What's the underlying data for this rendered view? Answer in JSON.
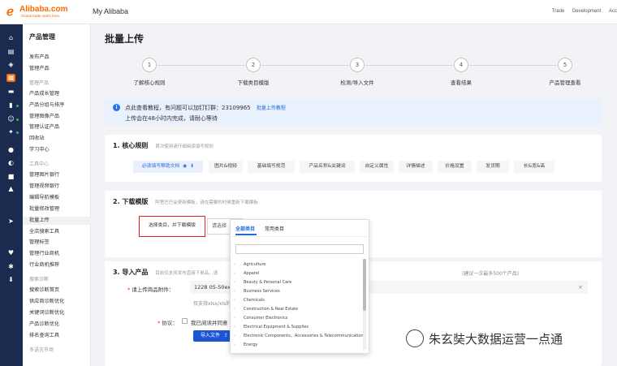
{
  "topbar": {
    "logo_name": "Alibaba.com",
    "logo_tagline": "Global trade starts here.",
    "site_title": "My Alibaba",
    "links": [
      "Trade",
      "Development",
      "Acc"
    ]
  },
  "rail": {
    "icons": [
      "home-icon",
      "inbox-icon",
      "shield-icon",
      "grid-icon",
      "message-icon",
      "chart-icon",
      "people-icon",
      "flash-icon",
      "user-icon",
      "bell-icon",
      "lock-icon",
      "bank-icon",
      "send-icon",
      "heart-icon",
      "settings-icon",
      "download-icon"
    ],
    "active_index": 3
  },
  "sidebar": {
    "title": "产品管理",
    "items": [
      {
        "kind": "item",
        "label": "发布产品"
      },
      {
        "kind": "item",
        "label": "管理产品"
      },
      {
        "kind": "group",
        "label": "管理产品"
      },
      {
        "kind": "item",
        "label": "产品成长管理"
      },
      {
        "kind": "item",
        "label": "产品分组与排序"
      },
      {
        "kind": "item",
        "label": "管理图像产品"
      },
      {
        "kind": "item",
        "label": "管理认证产品"
      },
      {
        "kind": "item",
        "label": "回收站"
      },
      {
        "kind": "item",
        "label": "学习中心"
      },
      {
        "kind": "group",
        "label": "工具中心"
      },
      {
        "kind": "item",
        "label": "管理图片银行"
      },
      {
        "kind": "item",
        "label": "管理视频银行"
      },
      {
        "kind": "item",
        "label": "编辑导航模板"
      },
      {
        "kind": "item",
        "label": "批量修改管理"
      },
      {
        "kind": "item",
        "label": "批量上传",
        "active": true
      },
      {
        "kind": "item",
        "label": "全店搜索工具"
      },
      {
        "kind": "item",
        "label": "管理标签"
      },
      {
        "kind": "item",
        "label": "管理行业商机"
      },
      {
        "kind": "item",
        "label": "行业商机推荐"
      },
      {
        "kind": "group",
        "label": "搜索诊断"
      },
      {
        "kind": "item",
        "label": "搜索诊断首页"
      },
      {
        "kind": "item",
        "label": "供应商诊断优化"
      },
      {
        "kind": "item",
        "label": "关键词诊断优化"
      },
      {
        "kind": "item",
        "label": "产品诊断优化"
      },
      {
        "kind": "item",
        "label": "排名查询工具"
      },
      {
        "kind": "group",
        "label": "多语言市场"
      }
    ]
  },
  "main": {
    "page_title": "批量上传",
    "steps": [
      {
        "num": "1",
        "label": "了解核心规则"
      },
      {
        "num": "2",
        "label": "下载类目模版"
      },
      {
        "num": "3",
        "label": "检测/导入文件"
      },
      {
        "num": "4",
        "label": "查看结果"
      },
      {
        "num": "5",
        "label": "产品管理查看"
      }
    ],
    "notice": {
      "icon": "info-icon",
      "line1": "点此查看教程，有问题可以加钉钉群：23109965",
      "link": "批量上传教程",
      "line2": "上传会在48小时内完成，请耐心等待"
    },
    "section1": {
      "title": "1. 核心规则",
      "subtitle": "首次使用请仔细阅读填写规则",
      "tags": [
        {
          "label": "必读填写帮助文档",
          "primary": true
        },
        {
          "label": "图片&视频"
        },
        {
          "label": "基础填写规范"
        },
        {
          "label": "产品名称&关键词"
        },
        {
          "label": "自定义属性"
        },
        {
          "label": "详情描述"
        },
        {
          "label": "价格设置"
        },
        {
          "label": "发货期"
        },
        {
          "label": "长&宽&高"
        }
      ]
    },
    "section2": {
      "title": "2. 下载模版",
      "subtitle": "阿里巴巴会更新模板，请在需要的时候重新下载模板",
      "select_button": "选择类目，并下载模版",
      "select_placeholder": "请选择"
    },
    "section3": {
      "title": "3. 导入产品",
      "subtitle": "目前仅支持发布直接下单品，请",
      "subtitle_right": "(建议一次最多500个产品)",
      "file_label": "请上传商品附件：",
      "file_value": "1228 05-50expon",
      "file_hint": "仅支持xlsx/xls的格式",
      "agree_label": "协议：",
      "agree_text": "我已阅读并同意",
      "import_button": "导入文件"
    }
  },
  "dropdown": {
    "tabs": [
      "全部类目",
      "常用类目"
    ],
    "search_value": "",
    "categories": [
      "Agriculture",
      "Apparel",
      "Beauty & Personal Care",
      "Business Services",
      "Chemicals",
      "Construction & Real Estate",
      "Consumer Electronics",
      "Electrical Equipment & Supplies",
      "Electronic Components，Accessories & Telecommunications",
      "Energy"
    ]
  },
  "watermark": {
    "text": "朱玄奘大数据运营一点通"
  }
}
